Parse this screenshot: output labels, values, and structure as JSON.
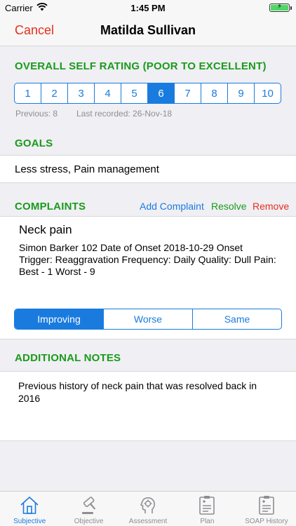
{
  "status_bar": {
    "carrier": "Carrier",
    "time": "1:45 PM"
  },
  "nav": {
    "cancel_label": "Cancel",
    "title": "Matilda Sullivan"
  },
  "self_rating": {
    "header": "OVERALL SELF RATING (POOR TO EXCELLENT)",
    "options": [
      "1",
      "2",
      "3",
      "4",
      "5",
      "6",
      "7",
      "8",
      "9",
      "10"
    ],
    "selected": "6",
    "previous": "Previous: 8",
    "last_recorded": "Last recorded: 26-Nov-18"
  },
  "goals": {
    "header": "GOALS",
    "text": "Less stress, Pain management"
  },
  "complaints": {
    "header": "COMPLAINTS",
    "add_label": "Add Complaint",
    "resolve_label": "Resolve",
    "remove_label": "Remove",
    "item": {
      "name": "Neck pain",
      "details": "Simon Barker 102  Date of Onset 2018-10-29  Onset Trigger: Reaggravation  Frequency: Daily  Quality: Dull Pain: Best - 1 Worst - 9"
    },
    "trend": {
      "options": [
        "Improving",
        "Worse",
        "Same"
      ],
      "selected": "Improving"
    }
  },
  "notes": {
    "header": "ADDITIONAL NOTES",
    "text": "Previous history of neck pain that was resolved back in 2016"
  },
  "tabs": [
    {
      "label": "Subjective",
      "icon": "house-icon",
      "active": true
    },
    {
      "label": "Objective",
      "icon": "gavel-icon",
      "active": false
    },
    {
      "label": "Assessment",
      "icon": "head-icon",
      "active": false
    },
    {
      "label": "Plan",
      "icon": "clipboard-icon",
      "active": false
    },
    {
      "label": "SOAP History",
      "icon": "clipboard-history-icon",
      "active": false
    }
  ],
  "colors": {
    "accent_blue": "#1a7bdf",
    "header_green": "#1a9b1a",
    "danger_red": "#e5301c",
    "background": "#efeff4"
  }
}
